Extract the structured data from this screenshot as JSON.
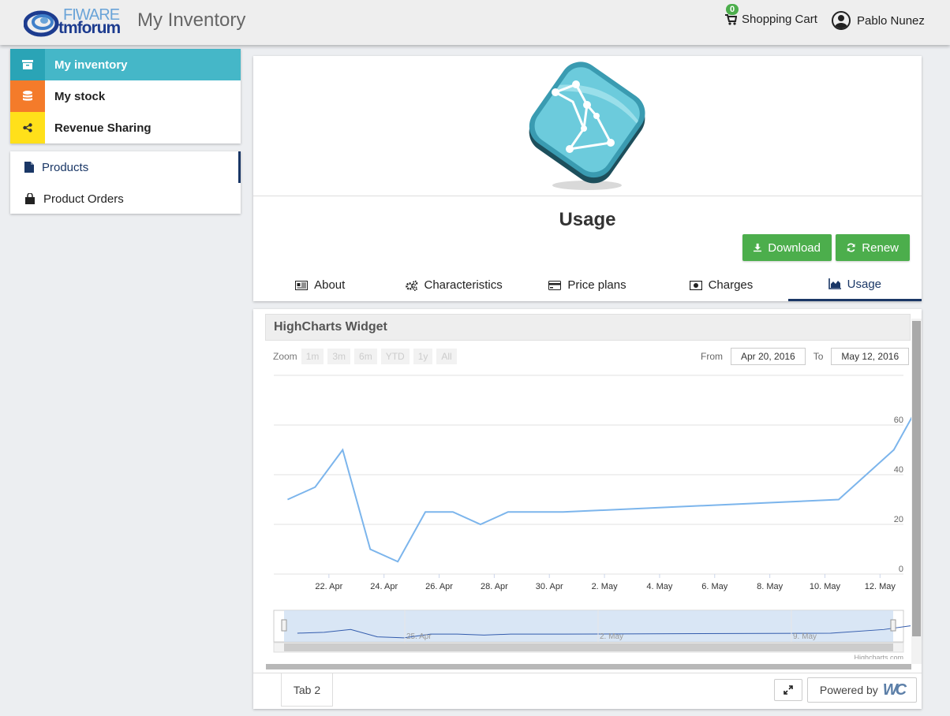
{
  "header": {
    "logo_top": "FIWARE",
    "logo_bottom": "tmforum",
    "title": "My Inventory",
    "cart_label": "Shopping Cart",
    "cart_count": "0",
    "user_name": "Pablo Nunez"
  },
  "sidebar": {
    "primary": [
      {
        "label": "My inventory",
        "icon": "archive-icon",
        "color": "#45b7c8"
      },
      {
        "label": "My stock",
        "icon": "database-icon",
        "color": "#f47b2a"
      },
      {
        "label": "Revenue Sharing",
        "icon": "share-icon",
        "color": "#ffe01a"
      }
    ],
    "secondary": [
      {
        "label": "Products",
        "icon": "file-icon"
      },
      {
        "label": "Product Orders",
        "icon": "shopping-bag-icon"
      }
    ]
  },
  "product": {
    "title": "Usage",
    "download_label": "Download",
    "renew_label": "Renew",
    "tabs": [
      {
        "label": "About",
        "icon": "newspaper-icon"
      },
      {
        "label": "Characteristics",
        "icon": "cogs-icon"
      },
      {
        "label": "Price plans",
        "icon": "credit-card-icon"
      },
      {
        "label": "Charges",
        "icon": "money-icon"
      },
      {
        "label": "Usage",
        "icon": "area-chart-icon"
      }
    ]
  },
  "widget": {
    "title": "HighCharts Widget",
    "zoom_label": "Zoom",
    "zoom_buttons": [
      "1m",
      "3m",
      "6m",
      "YTD",
      "1y",
      "All"
    ],
    "from_label": "From",
    "from_value": "Apr 20, 2016",
    "to_label": "To",
    "to_value": "May 12, 2016",
    "credits": "Highcharts.com",
    "tab_label": "Tab 2",
    "powered_by": "Powered by",
    "powered_logo": "WC"
  },
  "chart_data": {
    "type": "line",
    "x_ticks": [
      "22. Apr",
      "24. Apr",
      "26. Apr",
      "28. Apr",
      "30. Apr",
      "2. May",
      "4. May",
      "6. May",
      "8. May",
      "10. May",
      "12. May"
    ],
    "y_ticks": [
      "0",
      "20",
      "40",
      "60"
    ],
    "ylim": [
      0,
      80
    ],
    "series": [
      {
        "color": "#7cb5ec",
        "x": [
          20.5,
          21.5,
          22.5,
          23.5,
          24.5,
          25.5,
          26.5,
          27.5,
          28.5,
          29.5,
          30.5,
          40.5,
          42.5,
          43.5
        ],
        "y": [
          30,
          35,
          50,
          10,
          5,
          25,
          25,
          20,
          25,
          25,
          25,
          30,
          50,
          70
        ]
      }
    ],
    "navigator_labels": [
      "25. Apr",
      "2. May",
      "9. May"
    ]
  }
}
